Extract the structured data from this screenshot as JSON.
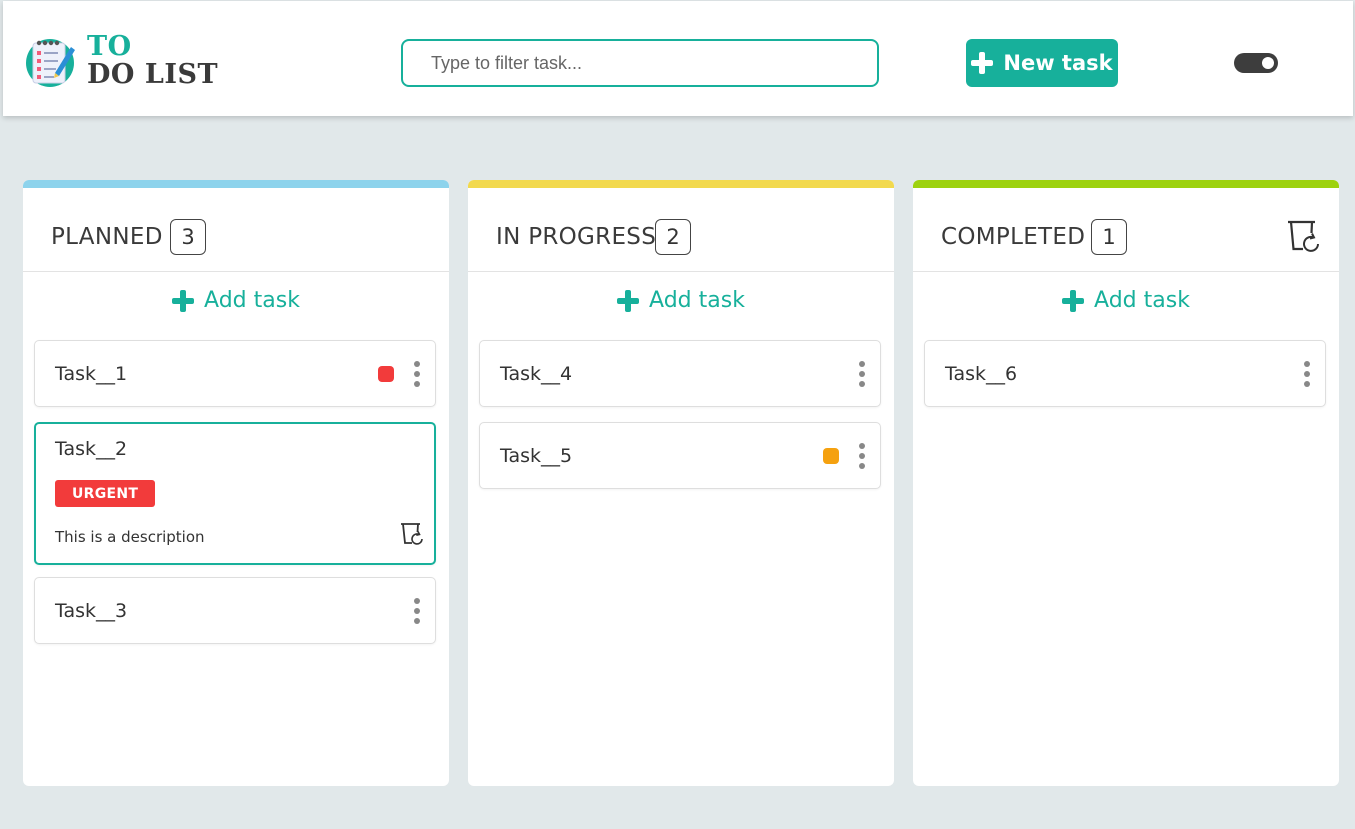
{
  "header": {
    "logo_line1": "TO",
    "logo_line2": "DO LIST",
    "search_placeholder": "Type to filter task...",
    "new_task_label": "New task",
    "theme_toggle_on": true
  },
  "colors": {
    "accent": "#17b09b",
    "planned": "#8dd3ec",
    "in_progress": "#f2d94e",
    "completed": "#9dd20f",
    "priority_red": "#f23b3b",
    "priority_orange": "#f5a10f",
    "urgent_badge": "#f23b3b"
  },
  "columns": [
    {
      "title": "PLANNED",
      "count": "3",
      "add_label": "Add task",
      "tasks": [
        {
          "title": "Task__1",
          "priority": "red"
        },
        {
          "title": "Task__2",
          "badge": "URGENT",
          "description": "This is a description"
        },
        {
          "title": "Task__3"
        }
      ]
    },
    {
      "title": "IN PROGRESS",
      "count": "2",
      "add_label": "Add task",
      "tasks": [
        {
          "title": "Task__4"
        },
        {
          "title": "Task__5",
          "priority": "orange"
        }
      ]
    },
    {
      "title": "COMPLETED",
      "count": "1",
      "add_label": "Add task",
      "tasks": [
        {
          "title": "Task__6"
        }
      ]
    }
  ]
}
